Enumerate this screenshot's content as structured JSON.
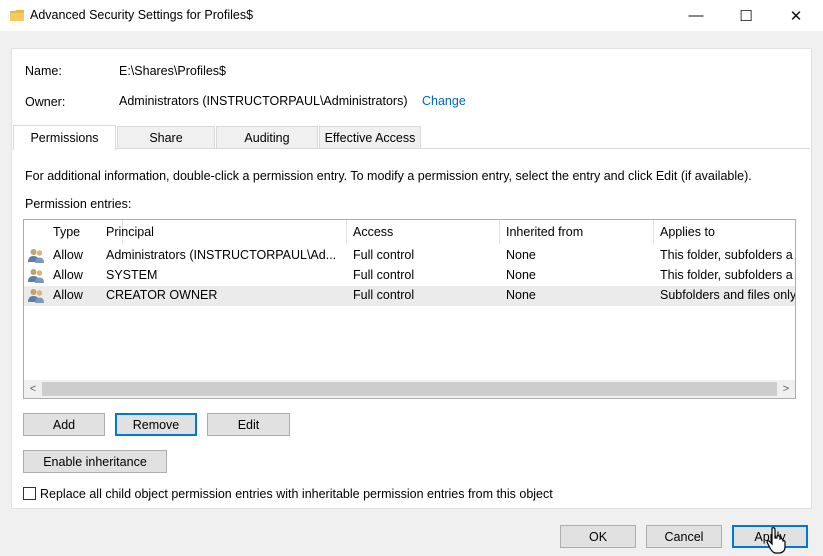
{
  "window": {
    "title": "Advanced Security Settings for Profiles$",
    "controls": {
      "minimize": "—",
      "maximize": "☐",
      "close": "✕"
    }
  },
  "info": {
    "name_label": "Name:",
    "name_value": "E:\\Shares\\Profiles$",
    "owner_label": "Owner:",
    "owner_value": "Administrators (INSTRUCTORPAUL\\Administrators)",
    "change_link": "Change"
  },
  "tabs": [
    "Permissions",
    "Share",
    "Auditing",
    "Effective Access"
  ],
  "active_tab": "Permissions",
  "permissions": {
    "info_text": "For additional information, double-click a permission entry. To modify a permission entry, select the entry and click Edit (if available).",
    "entries_label": "Permission entries:",
    "columns": [
      "Type",
      "Principal",
      "Access",
      "Inherited from",
      "Applies to"
    ],
    "rows": [
      [
        "Allow",
        "Administrators (INSTRUCTORPAUL\\Ad...",
        "Full control",
        "None",
        "This folder, subfolders a"
      ],
      [
        "Allow",
        "SYSTEM",
        "Full control",
        "None",
        "This folder, subfolders a"
      ],
      [
        "Allow",
        "CREATOR OWNER",
        "Full control",
        "None",
        "Subfolders and files only"
      ]
    ],
    "selected_row": 2,
    "scroll_left": "<",
    "scroll_right": ">",
    "add_button": "Add",
    "remove_button": "Remove",
    "edit_button": "Edit",
    "enable_inheritance_button": "Enable inheritance",
    "replace_checkbox_label": "Replace all child object permission entries with inheritable permission entries from this object",
    "replace_checked": false
  },
  "footer": {
    "ok": "OK",
    "cancel": "Cancel",
    "apply": "Apply"
  },
  "colors": {
    "link": "#0066cc",
    "focus": "#0078d7",
    "folder": "#e8b84a"
  },
  "icons": {
    "folder": "folder-icon",
    "user": "users-icon"
  }
}
